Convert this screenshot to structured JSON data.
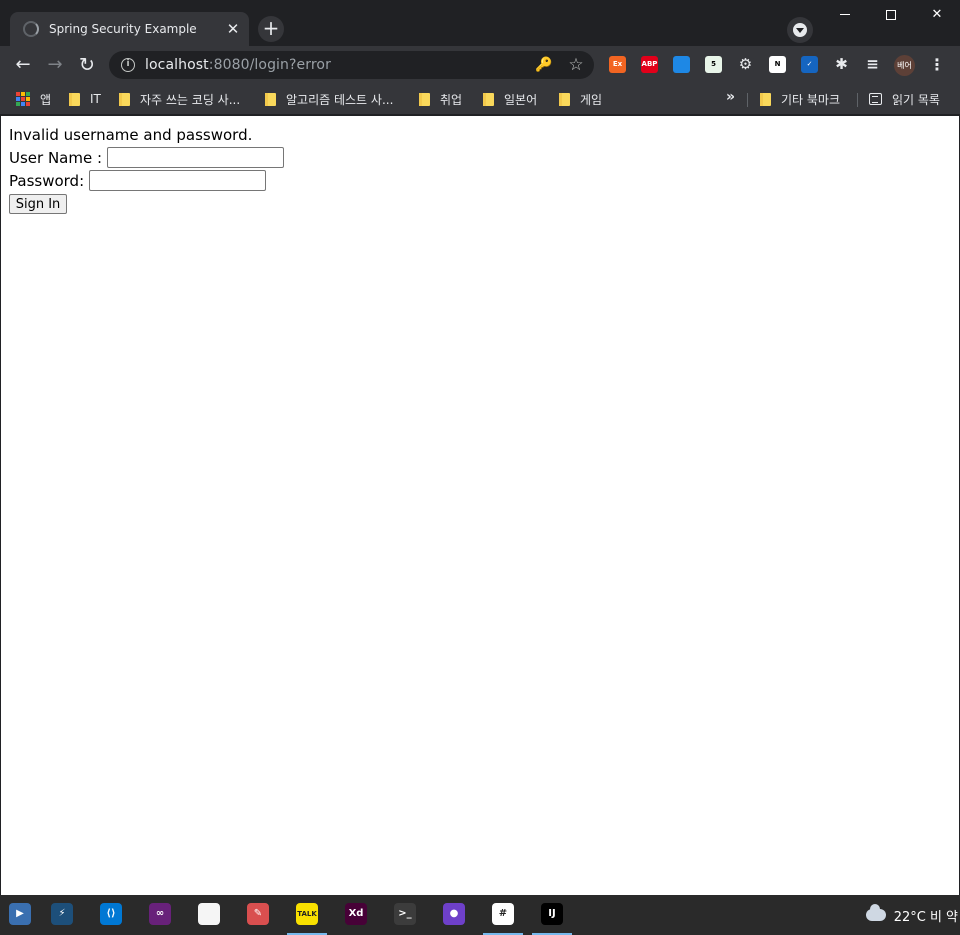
{
  "browser": {
    "tab": {
      "title": "Spring Security Example",
      "close_glyph": "✕"
    },
    "new_tab_glyph": "+",
    "window_controls": {
      "close_glyph": "✕"
    },
    "nav": {
      "back_glyph": "←",
      "forward_glyph": "→",
      "reload_glyph": "↻"
    },
    "address": {
      "host": "localhost",
      "rest": ":8080/login?error"
    },
    "omnibox_icons": {
      "key_glyph": "🔑",
      "star_glyph": "☆"
    },
    "extensions": [
      {
        "name": "extension-ex-icon",
        "label": "Ex",
        "color": "#f26522"
      },
      {
        "name": "adblock-plus-icon",
        "label": "ABP",
        "color": "#e2001a"
      },
      {
        "name": "extension-window-icon",
        "label": "",
        "color": "#1e88e5"
      },
      {
        "name": "extension-sheet-icon",
        "label": "5",
        "color": "#e8f5e9"
      },
      {
        "name": "extension-gear-icon",
        "label": "⚙",
        "color": "#35363a"
      },
      {
        "name": "notion-icon",
        "label": "N",
        "color": "#ffffff"
      },
      {
        "name": "extension-check-icon",
        "label": "✓",
        "color": "#1565c0"
      },
      {
        "name": "extensions-puzzle-icon",
        "label": "✱",
        "color": "#35363a"
      },
      {
        "name": "media-queue-icon",
        "label": "≡",
        "color": "#35363a"
      }
    ],
    "avatar_label": "베어",
    "menu_glyph": "⋮"
  },
  "bookmarks": {
    "apps_label": "앱",
    "items": [
      "IT",
      "자주 쓰는 코딩 사...",
      "알고리즘 테스트 사...",
      "취업",
      "일본어",
      "게임"
    ],
    "overflow_glyph": "»",
    "other_bookmarks": "기타 북마크",
    "reading_list": "읽기 목록"
  },
  "page": {
    "error_message": "Invalid username and password.",
    "username_label": "User Name :",
    "username_value": "",
    "password_label": "Password:",
    "password_value": "",
    "submit_label": "Sign In"
  },
  "taskbar": {
    "apps": [
      {
        "name": "taskbar-app-1-icon",
        "label": "▶",
        "color": "#3a6fb0",
        "running": false
      },
      {
        "name": "taskbar-mysql-workbench-icon",
        "label": "⚡",
        "color": "#1d4f7a",
        "running": false
      },
      {
        "name": "taskbar-vscode-icon",
        "label": "⟨⟩",
        "color": "#0078d4",
        "running": false
      },
      {
        "name": "taskbar-visual-studio-icon",
        "label": "∞",
        "color": "#68217a",
        "running": false
      },
      {
        "name": "taskbar-file-icon",
        "label": "",
        "color": "#f5f5f5",
        "running": false
      },
      {
        "name": "taskbar-paint-icon",
        "label": "✎",
        "color": "#d94f4f",
        "running": false
      },
      {
        "name": "taskbar-kakaotalk-icon",
        "label": "TALK",
        "color": "#f9e000",
        "running": true
      },
      {
        "name": "taskbar-adobe-xd-icon",
        "label": "Xd",
        "color": "#470137",
        "running": false
      },
      {
        "name": "taskbar-terminal-icon",
        "label": ">_",
        "color": "#3c3c3c",
        "running": false
      },
      {
        "name": "taskbar-github-icon",
        "label": "●",
        "color": "#6e40c9",
        "running": false
      },
      {
        "name": "taskbar-slack-icon",
        "label": "#",
        "color": "#ffffff",
        "running": true
      },
      {
        "name": "taskbar-intellij-icon",
        "label": "IJ",
        "color": "#000000",
        "running": true
      }
    ],
    "weather": "22°C 비 약"
  },
  "colors": {
    "chrome_frame": "#202124",
    "chrome_toolbar": "#35363a",
    "page_bg": "#ffffff",
    "taskbar_bg": "#2a2a2a",
    "taskbar_active": "#76b9ed"
  }
}
